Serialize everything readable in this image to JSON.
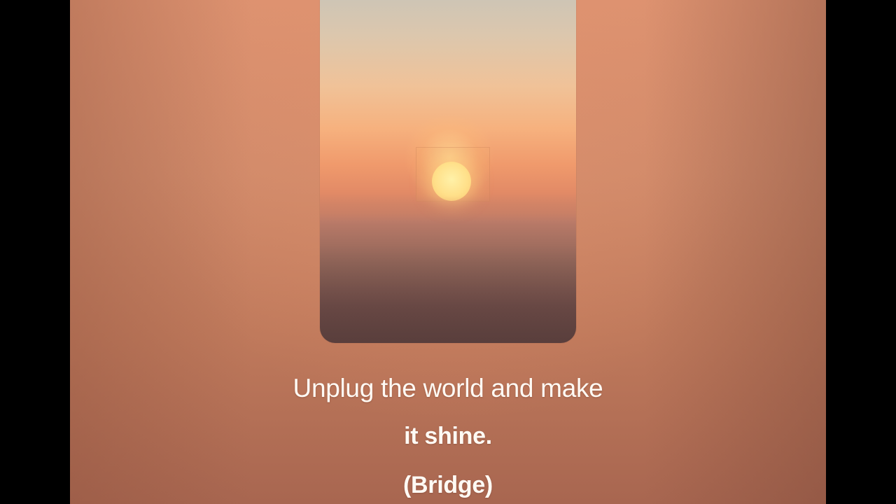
{
  "video": {
    "colors": {
      "background_top": "#dd9270",
      "background_bottom": "#a86650",
      "sun": "#ffe08a",
      "lyric_text": "#fffaf4"
    }
  },
  "lyrics": {
    "line_1": "Unplug the world and make",
    "line_2": "it shine.",
    "line_3": "(Bridge)"
  }
}
